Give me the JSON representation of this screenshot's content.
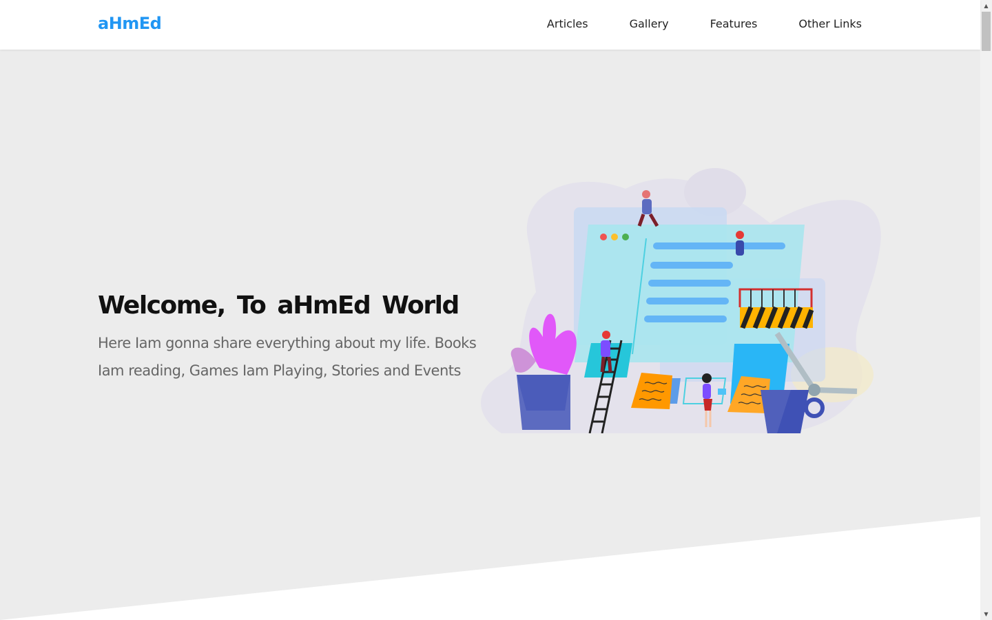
{
  "header": {
    "logo": "aHmEd",
    "nav": [
      {
        "label": "Articles"
      },
      {
        "label": "Gallery"
      },
      {
        "label": "Features"
      },
      {
        "label": "Other Links"
      }
    ]
  },
  "hero": {
    "title": "Welcome, To aHmEd World",
    "description": "Here Iam gonna share everything about my life. Books Iam reading, Games Iam Playing, Stories and Events",
    "illustration": "website-construction-illustration"
  },
  "colors": {
    "brand": "#2196f3",
    "hero_bg": "#ececec"
  },
  "icons": {
    "scroll_up": "triangle-up-icon",
    "scroll_down": "triangle-down-icon"
  }
}
